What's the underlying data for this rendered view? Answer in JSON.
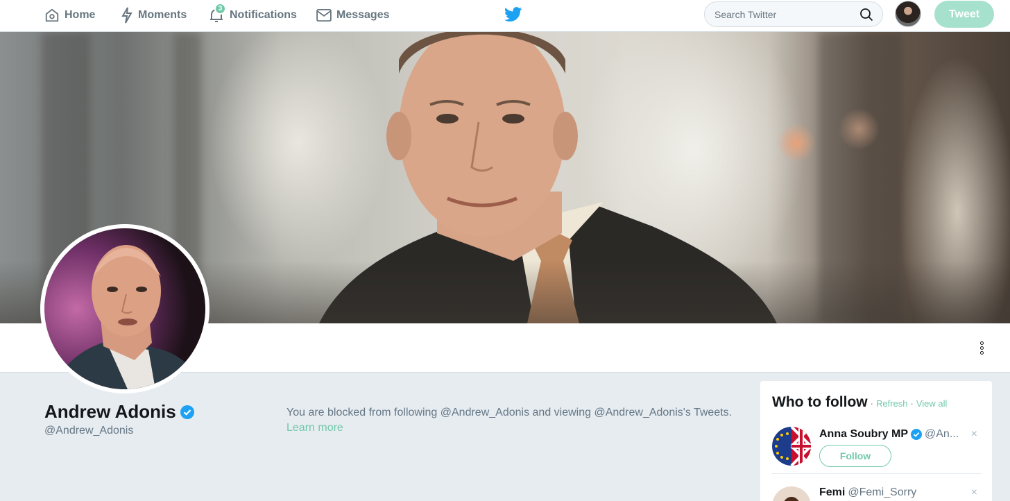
{
  "nav": {
    "home_label": "Home",
    "moments_label": "Moments",
    "notifications_label": "Notifications",
    "notifications_count": "3",
    "messages_label": "Messages",
    "search_placeholder": "Search Twitter",
    "tweet_button_label": "Tweet"
  },
  "profile": {
    "name": "Andrew Adonis",
    "handle": "@Andrew_Adonis",
    "verified": true
  },
  "blocked_notice": {
    "text": "You are blocked from following @Andrew_Adonis and viewing @Andrew_Adonis's Tweets.",
    "learn_more": "Learn more"
  },
  "who_to_follow": {
    "title": "Who to follow",
    "separator": "·",
    "refresh": "Refresh",
    "view_all": "View all",
    "suggestions": [
      {
        "name": "Anna Soubry MP",
        "handle": "@AnnaSoubry",
        "handle_display": "@An...",
        "verified": true,
        "follow_label": "Follow",
        "dismiss": "×"
      },
      {
        "name": "Femi",
        "handle": "@Femi_Sorry",
        "verified": false,
        "dismiss": "×"
      }
    ]
  },
  "colors": {
    "accent": "#71c9a9",
    "twitter_blue": "#1da1f2",
    "tweet_button": "#a6e1cd",
    "page_bg": "#e6ecf0"
  },
  "icons": {
    "home": "home-icon",
    "moments": "lightning-icon",
    "notifications": "bell-icon",
    "messages": "envelope-icon",
    "brand": "twitter-bird-icon",
    "search": "search-icon",
    "verified": "verified-badge-icon",
    "more": "more-vertical-icon",
    "dismiss": "close-icon"
  }
}
